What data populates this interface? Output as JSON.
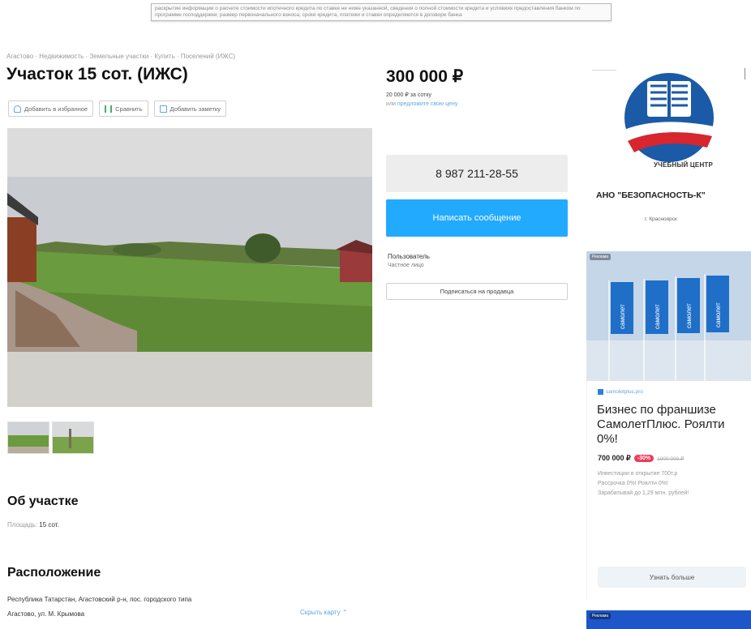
{
  "banner": {
    "text": "раскрытие информации о расчете стоимости ипотечного кредита по ставке не ниже указанной, сведения о полной стоимости кредита и условиях предоставления банком по программе господдержки; размер первоначального взноса, сроки кредита, платежи и ставки определяются в договоре банка"
  },
  "breadcrumbs": [
    "Агастово",
    "Недвижимость",
    "Земельные участки",
    "Купить",
    "Поселений (ИЖС)"
  ],
  "listing": {
    "title": "Участок 15 сот. (ИЖС)",
    "add_favorite": "Добавить в избранное",
    "compare": "Сравнить",
    "add_note": "Добавить заметку"
  },
  "pricing": {
    "price": "300 000 ₽",
    "per_unit": "20 000 ₽ за сотку",
    "offer_prefix": "или",
    "offer_link": "предложите свою цену"
  },
  "contact": {
    "phone": "8 987 211-28-55",
    "message_button": "Написать сообщение",
    "seller_role": "Пользователь",
    "seller_type": "Частное лицо",
    "subscribe": "Подписаться на продавца"
  },
  "about": {
    "heading": "Об участке",
    "area_label": "Площадь:",
    "area_value": "15 сот."
  },
  "location": {
    "heading": "Расположение",
    "address_line1": "Республика Татарстан, Агастовский р-н, пос. городского типа",
    "address_line2": "Агастово, ул. М. Крымова",
    "map_link": "Скрыть карту ⌃"
  },
  "ad_school": {
    "caption": "УЧЕБНЫЙ ЦЕНТР",
    "name": "АНО \"БЕЗОПАСНОСТЬ-К\"",
    "city": "г. Красноярск"
  },
  "ad_samolet": {
    "label": "Реклама",
    "flag_text": "самолет",
    "domain": "samoletplus.pro",
    "title": "Бизнес по франшизе СамолетПлюс. Роялти 0%!",
    "price": "700 000 ₽",
    "discount": "-30%",
    "old_price": "1000 000 ₽",
    "desc_lines": [
      "Инвестиции в открытие 700т.р",
      "Рассрочка 0%! Роялти 0%!",
      "Зарабатывай до 1,29 млн. рублей!"
    ],
    "more_button": "Узнать больше"
  },
  "ad_bottom": {
    "label": "Реклама"
  },
  "colors": {
    "accent": "#22aaff",
    "link": "#5aa8e6",
    "discount": "#ef3b5b",
    "school_blue": "#1b5aa6",
    "school_red": "#d7262d"
  }
}
